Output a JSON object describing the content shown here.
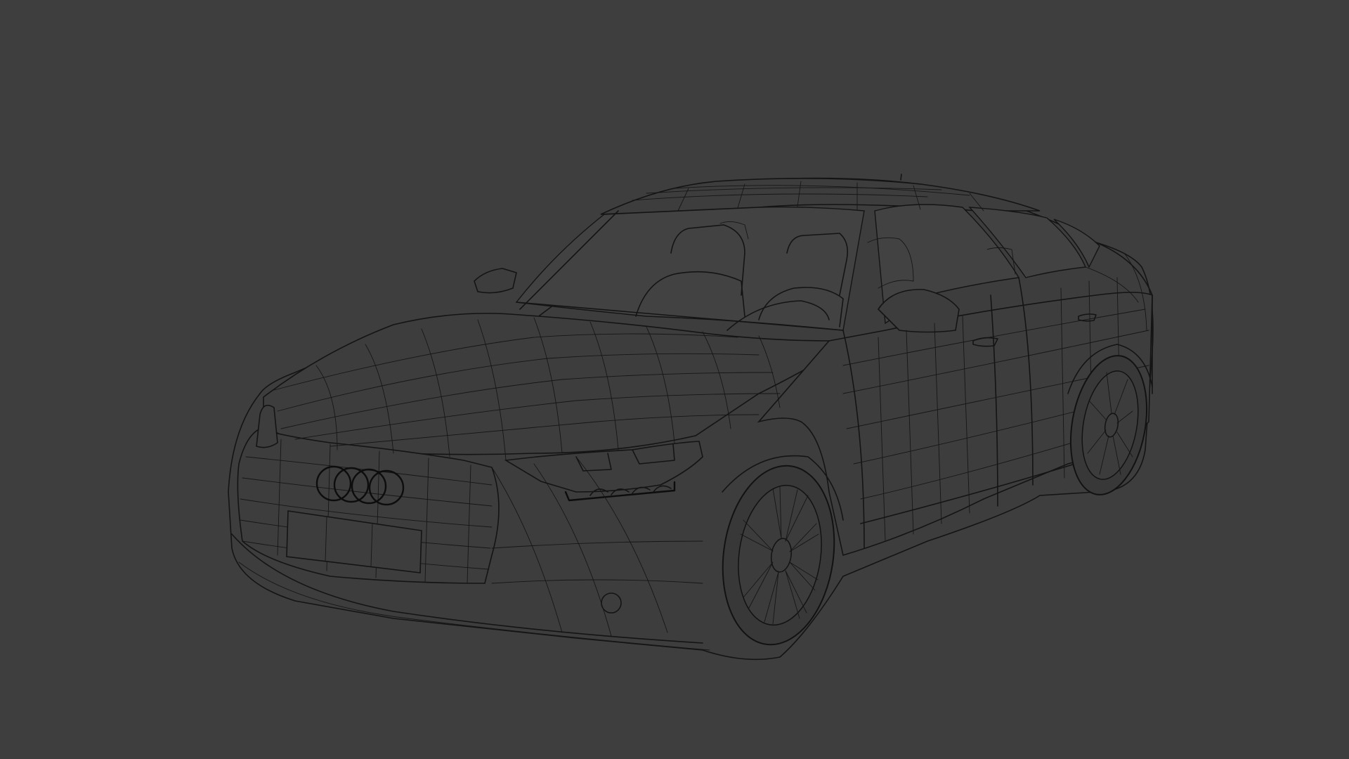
{
  "viewport": {
    "background_color": "#3e3e3e",
    "wire_color": "#141414",
    "subject": "sedan",
    "display_mode": "wireframe"
  }
}
